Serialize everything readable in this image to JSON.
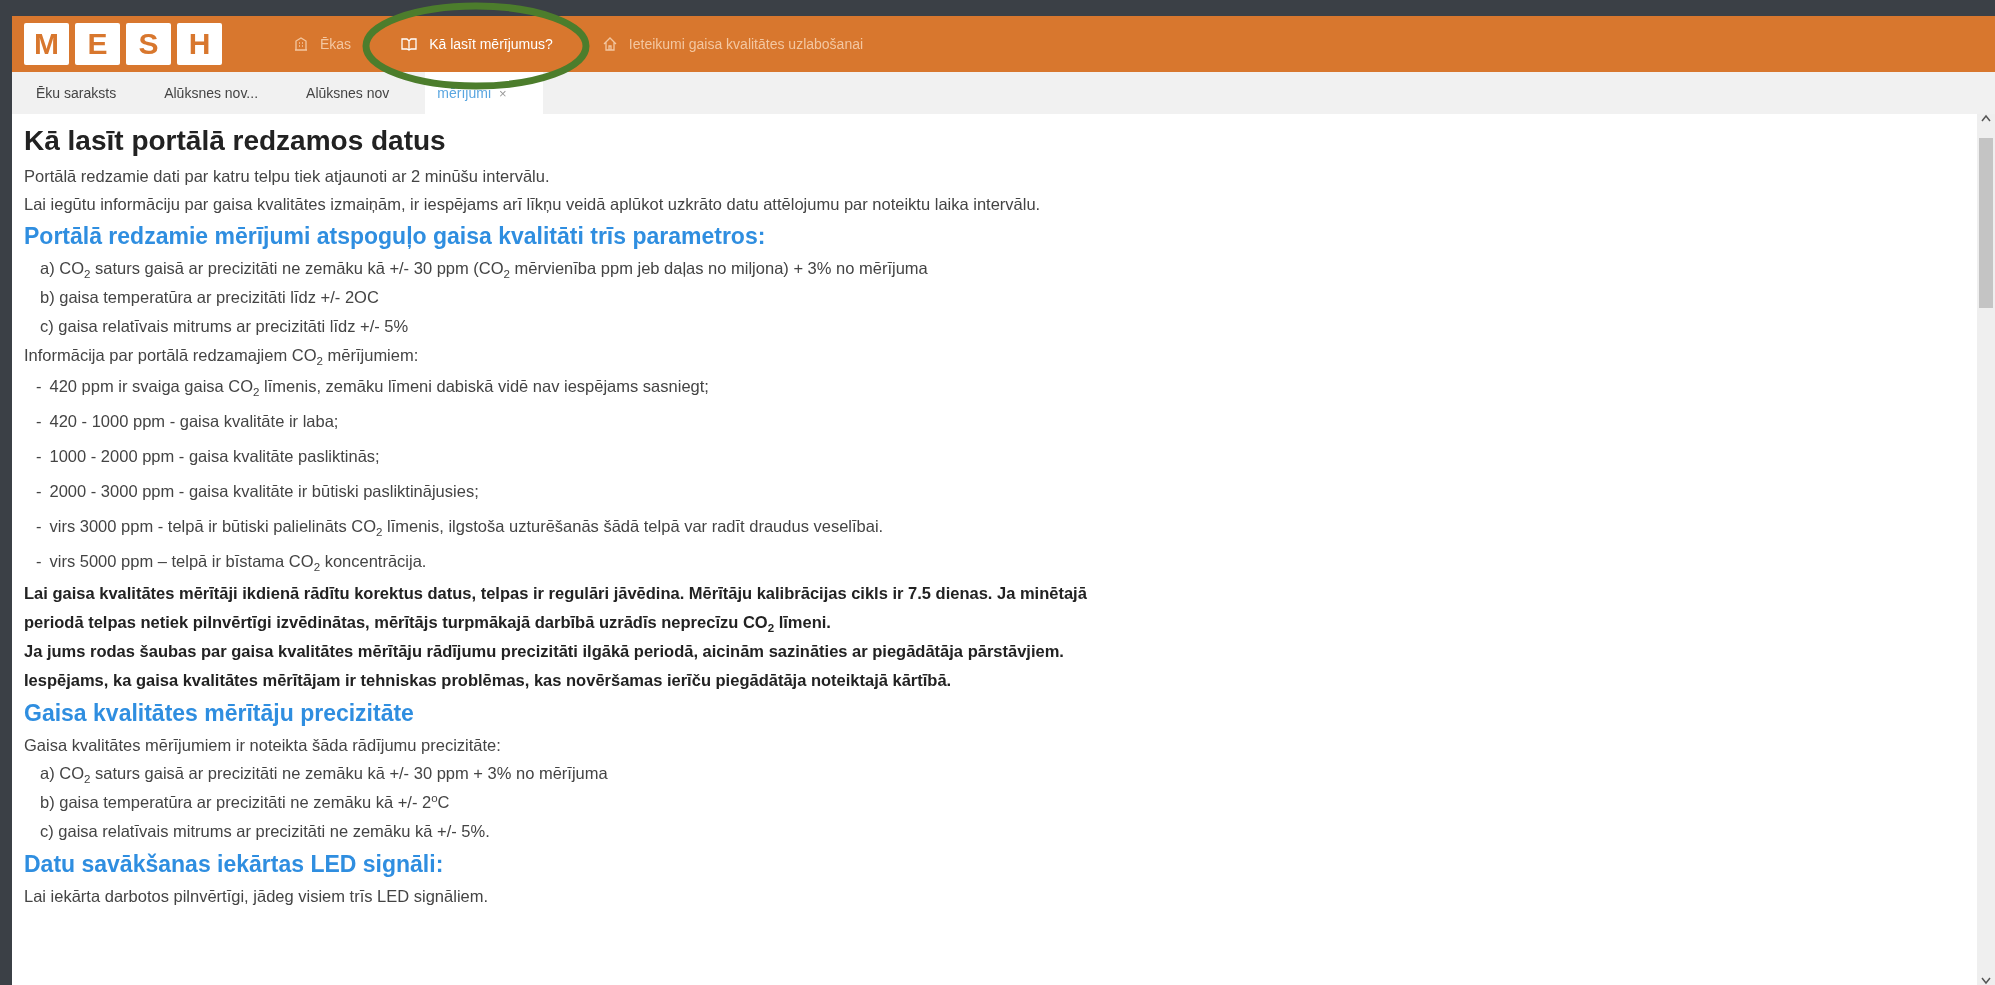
{
  "header": {
    "logo": [
      "M",
      "E",
      "S",
      "H"
    ],
    "nav": [
      {
        "label": "Ēkas",
        "selected": false
      },
      {
        "label": "Kā lasīt mērījumus?",
        "selected": true
      },
      {
        "label": "Ieteikumi gaisa kvalitātes uzlabošanai",
        "selected": false
      }
    ]
  },
  "tabs": [
    {
      "label": "Ēku saraksts",
      "selected": false
    },
    {
      "label": "Alūksnes nov...",
      "selected": false
    },
    {
      "label": "Alūksnes nov",
      "selected": false
    },
    {
      "label": "mērījumi",
      "close": "×",
      "selected": true
    }
  ],
  "content": [
    {
      "kind": "title",
      "text": "Kā lasīt portālā redzamos datus"
    },
    {
      "kind": "paragraph",
      "text": "Portālā redzamie dati par katru telpu tiek atjaunoti ar 2 minūšu intervālu."
    },
    {
      "kind": "paragraph",
      "text": "Lai iegūtu informāciju par gaisa kvalitātes izmaiņām, ir iespējams arī līkņu veidā aplūkot uzkrāto datu attēlojumu par noteiktu laika intervālu."
    },
    {
      "kind": "heading",
      "text": "Portālā redzamie mērījumi atspoguļo gaisa kvalitāti trīs parametros:"
    },
    {
      "kind": "indent",
      "text": "a) CO$_{2}$ saturs gaisā ar precizitāti ne zemāku kā +/- 30 ppm (CO$_{2}$ mērvienība ppm jeb daļas no miljona) + 3% no mērījuma"
    },
    {
      "kind": "indent",
      "text": "b) gaisa temperatūra ar precizitāti līdz +/- 2OC"
    },
    {
      "kind": "indent",
      "text": "c) gaisa relatīvais mitrums ar precizitāti līdz +/- 5%"
    },
    {
      "kind": "paragraph",
      "text": "Informācija par portālā redzamajiem CO$_{2}$ mērījumiem:"
    },
    {
      "kind": "dash",
      "mark": "-",
      "text": "420 ppm ir svaiga gaisa CO$_{2}$ līmenis, zemāku līmeni dabiskā vidē nav iespējams sasniegt;"
    },
    {
      "kind": "dash",
      "mark": "-",
      "text": "420 - 1000 ppm - gaisa kvalitāte ir laba;"
    },
    {
      "kind": "dash",
      "mark": "-",
      "text": "1000 - 2000 ppm - gaisa kvalitāte pasliktinās;"
    },
    {
      "kind": "dash",
      "mark": "-",
      "text": "2000 - 3000 ppm - gaisa kvalitāte ir būtiski pasliktinājusies;"
    },
    {
      "kind": "dash",
      "mark": "-",
      "text": "virs 3000 ppm - telpā ir būtiski palielināts CO$_{2}$ līmenis, ilgstoša uzturēšanās šādā telpā var radīt draudus veselībai."
    },
    {
      "kind": "dash",
      "mark": "-",
      "text": "virs 5000 ppm – telpā ir bīstama CO$_{2}$ koncentrācija."
    },
    {
      "kind": "bold",
      "text": "Lai gaisa kvalitātes mērītāji ikdienā rādītu korektus datus, telpas ir regulāri jāvēdina. Mērītāju kalibrācijas cikls ir 7.5 dienas. Ja minētajā periodā telpas netiek pilnvērtīgi izvēdinātas, mērītājs turpmākajā darbībā uzrādīs neprecīzu CO$_{2}$ līmeni."
    },
    {
      "kind": "bold",
      "text": "Ja jums rodas šaubas par gaisa kvalitātes mērītāju rādījumu precizitāti ilgākā periodā, aicinām sazināties ar piegādātāja pārstāvjiem. Iespējams, ka gaisa kvalitātes mērītājam ir tehniskas problēmas, kas novēršamas ierīču piegādātāja noteiktajā kārtībā."
    },
    {
      "kind": "heading",
      "text": "Gaisa kvalitātes mērītāju precizitāte"
    },
    {
      "kind": "paragraph",
      "text": "Gaisa kvalitātes mērījumiem ir noteikta šāda rādījumu precizitāte:"
    },
    {
      "kind": "indent",
      "text": "a) CO$_{2}$ saturs gaisā ar precizitāti ne zemāku kā +/- 30 ppm + 3% no mērījuma"
    },
    {
      "kind": "indent",
      "text": "b) gaisa temperatūra ar precizitāti ne zemāku kā +/- 2$^{o}$C"
    },
    {
      "kind": "indent",
      "text": "c) gaisa relatīvais mitrums ar precizitāti ne zemāku kā +/- 5%."
    },
    {
      "kind": "heading",
      "text": "Datu savākšanas iekārtas LED signāli:"
    },
    {
      "kind": "paragraph",
      "text": "Lai iekārta darbotos pilnvērtīgi, jādeg visiem trīs LED signāliem."
    }
  ],
  "annotation": {
    "kind": "ellipse"
  }
}
